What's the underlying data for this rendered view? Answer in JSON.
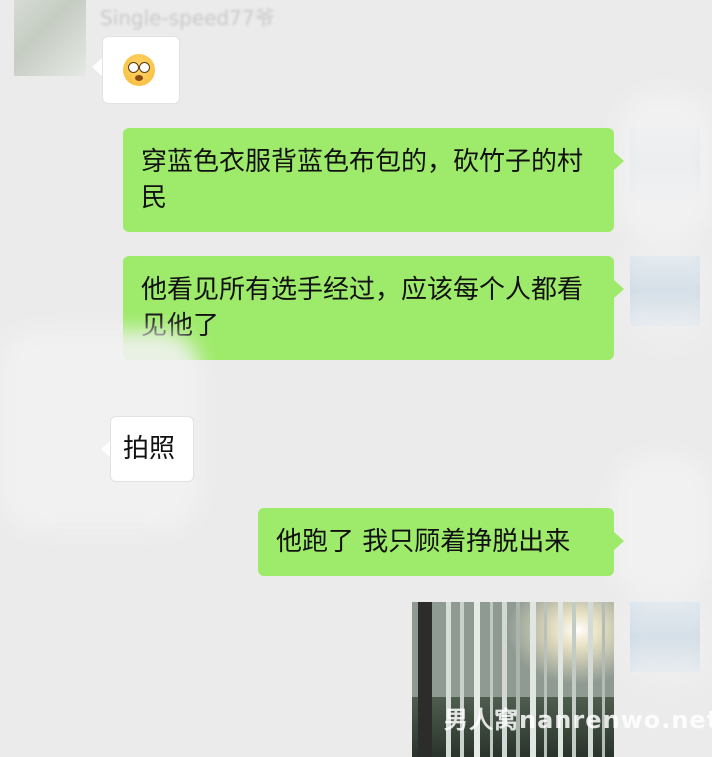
{
  "chat": {
    "sender_name": "Single-speed77爷",
    "messages": [
      {
        "side": "left",
        "type": "emoji",
        "icon": "astonished-face-icon"
      },
      {
        "side": "right",
        "type": "text",
        "text": "穿蓝色衣服背蓝色布包的，砍竹子的村民"
      },
      {
        "side": "right",
        "type": "text",
        "text": "他看见所有选手经过，应该每个人都看见他了"
      },
      {
        "side": "left",
        "type": "text",
        "text": "拍照"
      },
      {
        "side": "right",
        "type": "text",
        "text": "他跑了 我只顾着挣脱出来"
      },
      {
        "side": "right",
        "type": "image",
        "icon": "bamboo-forest-photo"
      }
    ]
  },
  "watermark": "男人窝nanrenwo.net",
  "colors": {
    "background": "#ebebeb",
    "bubble_green": "#9eea6a",
    "bubble_white": "#ffffff"
  }
}
